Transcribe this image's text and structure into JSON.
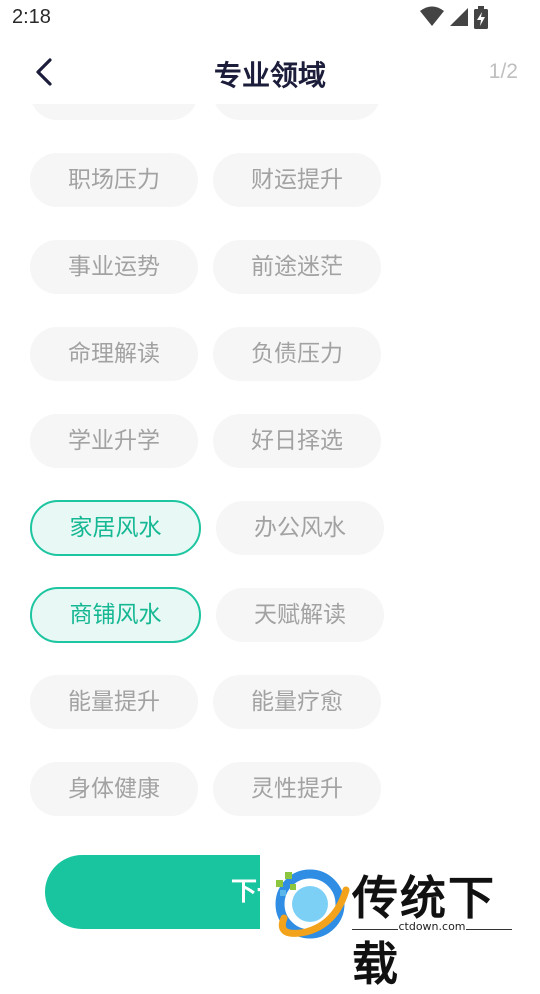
{
  "status_bar": {
    "time": "2:18",
    "icons": [
      "wifi-icon",
      "signal-icon",
      "battery-charging-icon"
    ]
  },
  "header": {
    "back_icon": "chevron-left-icon",
    "title": "专业领域",
    "page_counter": "1/2"
  },
  "tags": [
    {
      "label": "",
      "selected": false
    },
    {
      "label": "",
      "selected": false
    },
    {
      "label": "职场压力",
      "selected": false
    },
    {
      "label": "财运提升",
      "selected": false
    },
    {
      "label": "事业运势",
      "selected": false
    },
    {
      "label": "前途迷茫",
      "selected": false
    },
    {
      "label": "命理解读",
      "selected": false
    },
    {
      "label": "负债压力",
      "selected": false
    },
    {
      "label": "学业升学",
      "selected": false
    },
    {
      "label": "好日择选",
      "selected": false
    },
    {
      "label": "家居风水",
      "selected": true
    },
    {
      "label": "办公风水",
      "selected": false
    },
    {
      "label": "商铺风水",
      "selected": true
    },
    {
      "label": "天赋解读",
      "selected": false
    },
    {
      "label": "能量提升",
      "selected": false
    },
    {
      "label": "能量疗愈",
      "selected": false
    },
    {
      "label": "身体健康",
      "selected": false
    },
    {
      "label": "灵性提升",
      "selected": false
    }
  ],
  "next_button": {
    "label": "下一步"
  },
  "watermark": {
    "brand": "传统下载",
    "url": "ctdown.com",
    "logo_icon": "ctdown-logo-icon"
  },
  "colors": {
    "accent": "#18c59f",
    "selected_bg": "#e8f8f4",
    "selected_border": "#1ec5a1",
    "tag_bg": "#f6f6f6",
    "tag_text": "#a2a2a2",
    "title": "#1b1d3a"
  }
}
